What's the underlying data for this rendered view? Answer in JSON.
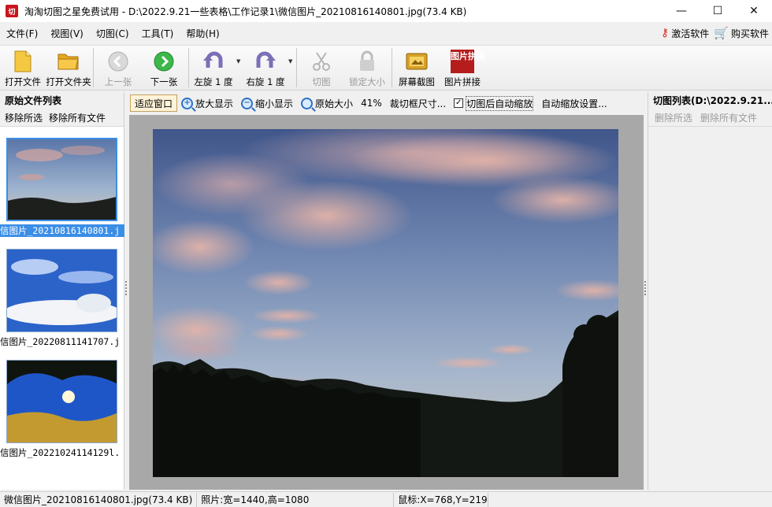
{
  "window": {
    "app_icon_text": "切",
    "title": "淘淘切图之星免费试用 - D:\\2022.9.21一些表格\\工作记录1\\微信图片_20210816140801.jpg(73.4 KB)",
    "minimize": "—",
    "maximize": "☐",
    "close": "✕"
  },
  "menu": {
    "items": [
      "文件(F)",
      "视图(V)",
      "切图(C)",
      "工具(T)",
      "帮助(H)"
    ],
    "activate": "激活软件",
    "buy": "购买软件"
  },
  "toolbar": {
    "open_file": "打开文件",
    "open_folder": "打开文件夹",
    "prev": "上一张",
    "next": "下一张",
    "rotate_left": "左旋 1 度",
    "rotate_right": "右旋 1 度",
    "cut": "切图",
    "lock_size": "锁定大小",
    "screenshot": "屏幕截图",
    "stitch": "图片拼接",
    "stitch_icon_text": "图片拼接"
  },
  "left_panel": {
    "title": "原始文件列表",
    "remove_selected": "移除所选",
    "remove_all": "移除所有文件",
    "files": [
      {
        "label": "信图片_20210816140801.j",
        "selected": true
      },
      {
        "label": "信图片_20220811141707.j",
        "selected": false
      },
      {
        "label": "信图片_20221024114129l.",
        "selected": false
      }
    ]
  },
  "viewbar": {
    "fit_window": "适应窗口",
    "zoom_in": "放大显示",
    "zoom_out": "缩小显示",
    "original_size": "原始大小",
    "zoom_percent": "41%",
    "crop_size": "裁切框尺寸...",
    "auto_zoom_after_cut": "切图后自动缩放",
    "auto_zoom_checked": "✓",
    "auto_zoom_settings": "自动缩放设置..."
  },
  "right_panel": {
    "title": "切图列表(D:\\2022.9.21...",
    "delete_selected": "删除所选",
    "delete_all": "删除所有文件"
  },
  "status": {
    "file": "微信图片_20210816140801.jpg(73.4 KB)",
    "photo_size": "照片:宽=1440,高=1080",
    "mouse": "鼠标:X=768,Y=219"
  },
  "colors": {
    "accent": "#3b8ee6",
    "danger": "#d8261b"
  }
}
